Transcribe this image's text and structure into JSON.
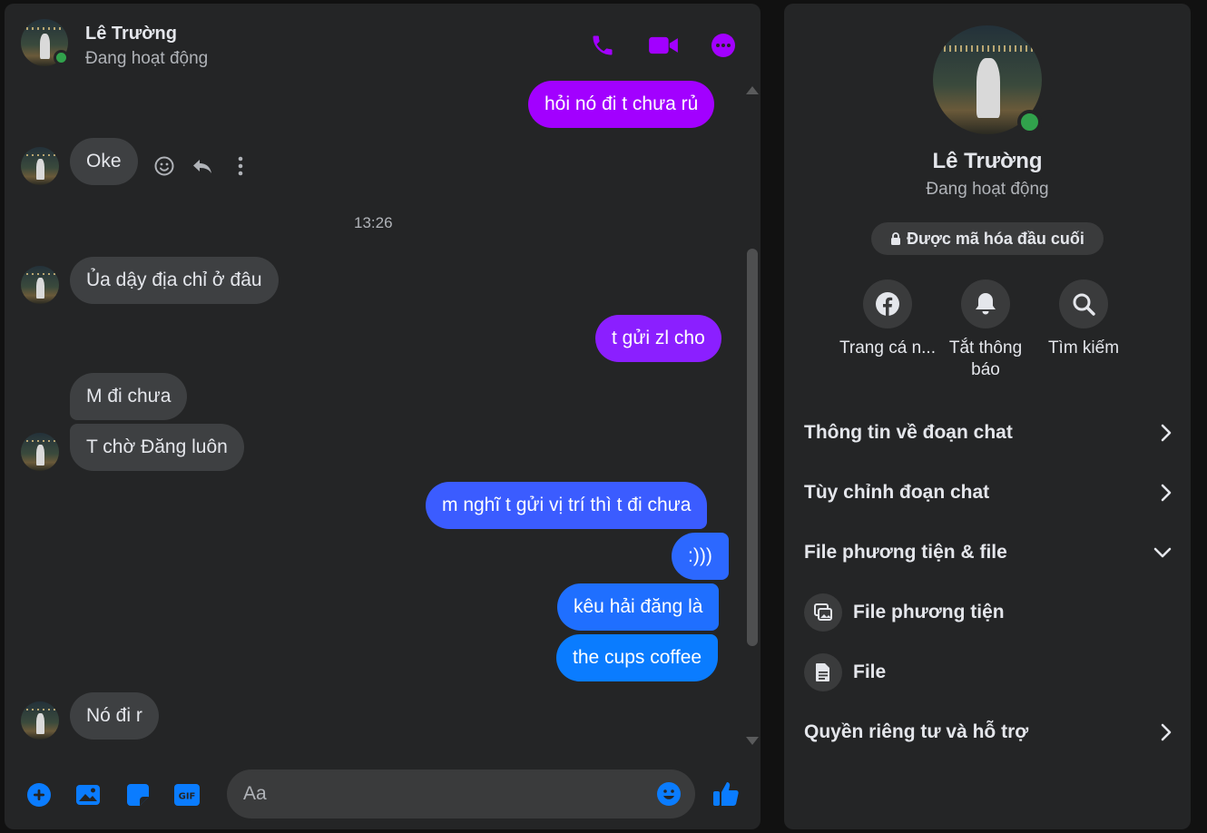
{
  "colors": {
    "accent_purple": "#a200ff",
    "accent_blue": "#0a7cff",
    "bubble_in": "#3e4042",
    "online": "#31a24c"
  },
  "header": {
    "name": "Lê Trường",
    "status": "Đang hoạt động"
  },
  "messages": {
    "m1": "hỏi nó đi t chưa rủ",
    "m2": "Oke",
    "time": "13:26",
    "m3": "Ủa dậy địa chỉ ở đâu",
    "m4": "t gửi zl cho",
    "m5": "M đi chưa",
    "m6": "T chờ Đăng luôn",
    "m7": "m nghĩ t gửi vị trí thì t đi chưa",
    "m8": ":)))",
    "m9": "kêu hải đăng là",
    "m10": "the cups coffee",
    "m11": "Nó đi r"
  },
  "composer": {
    "placeholder": "Aa"
  },
  "info": {
    "name": "Lê Trường",
    "status": "Đang hoạt động",
    "e2e": "Được mã hóa đầu cuối",
    "actions": [
      {
        "label": "Trang cá n...",
        "icon": "facebook-icon"
      },
      {
        "label": "Tắt thông báo",
        "icon": "bell-icon"
      },
      {
        "label": "Tìm kiếm",
        "icon": "search-icon"
      }
    ],
    "rows": {
      "chat_info": "Thông tin về đoạn chat",
      "customize": "Tùy chỉnh đoạn chat",
      "media_files": "File phương tiện & file",
      "media": "File phương tiện",
      "file": "File",
      "privacy": "Quyền riêng tư và hỗ trợ"
    }
  }
}
